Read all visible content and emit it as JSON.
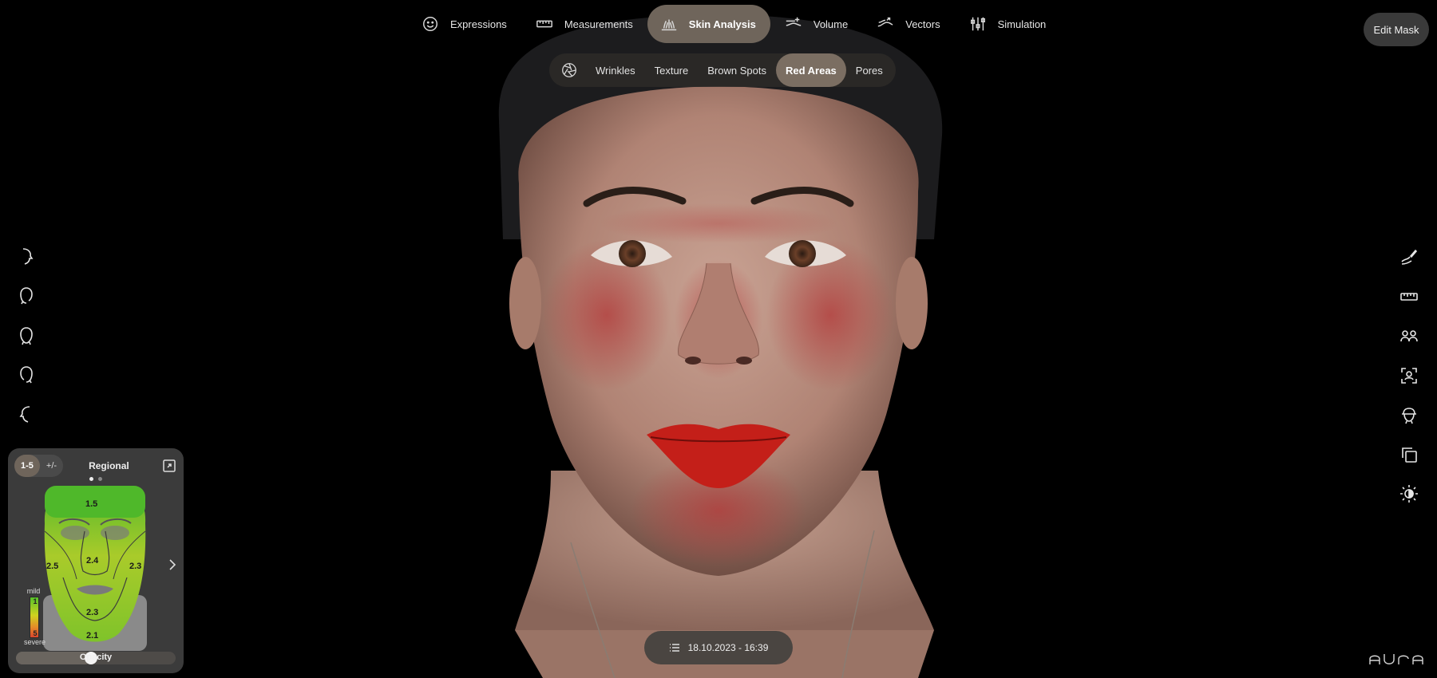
{
  "top_nav": {
    "items": [
      {
        "label": "Expressions",
        "icon": "smiley-icon"
      },
      {
        "label": "Measurements",
        "icon": "ruler-icon"
      },
      {
        "label": "Skin Analysis",
        "icon": "skin-analysis-icon",
        "active": true
      },
      {
        "label": "Volume",
        "icon": "volume-icon"
      },
      {
        "label": "Vectors",
        "icon": "vectors-icon"
      },
      {
        "label": "Simulation",
        "icon": "sliders-icon"
      }
    ],
    "edit_mask_label": "Edit Mask"
  },
  "sub_nav": {
    "icon": "aperture-icon",
    "items": [
      {
        "label": "Wrinkles"
      },
      {
        "label": "Texture"
      },
      {
        "label": "Brown Spots"
      },
      {
        "label": "Red Areas",
        "active": true
      },
      {
        "label": "Pores"
      }
    ]
  },
  "left_tools": [
    "head-right-profile-icon",
    "head-right-oblique-icon",
    "head-front-icon",
    "head-left-oblique-icon",
    "head-left-profile-icon"
  ],
  "right_tools": [
    "draw-pen-icon",
    "ruler-icon",
    "compare-users-icon",
    "scan-face-icon",
    "head-orientation-icon",
    "duplicate-icon",
    "brightness-icon"
  ],
  "regional_panel": {
    "scale_options": [
      "1-5",
      "+/-"
    ],
    "selected_scale": "1-5",
    "title": "Regional",
    "page_index": 1,
    "page_count": 2,
    "regions": {
      "forehead": "1.5",
      "right_cheek": "2.5",
      "nose": "2.4",
      "left_cheek": "2.3",
      "mouth": "2.3",
      "chin": "2.1"
    },
    "legend": {
      "mild_label": "mild",
      "severe_label": "severe",
      "low": "1",
      "high": "5"
    },
    "opacity_label": "Opacity",
    "opacity_value": 0.47
  },
  "date_chip": {
    "label": "18.10.2023 - 16:39",
    "icon": "list-icon"
  },
  "brand": {
    "logo": "AURA"
  },
  "colors": {
    "accent": "#6f655b",
    "panel": "#3b3b3b",
    "background": "#000000"
  }
}
